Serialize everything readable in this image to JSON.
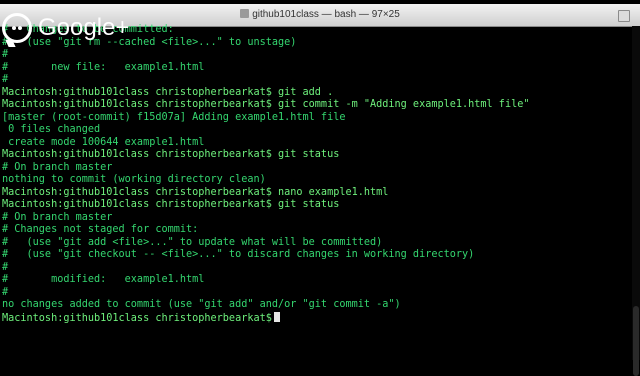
{
  "window": {
    "title": "github101class — bash — 97×25"
  },
  "overlay": {
    "label": "Google+"
  },
  "terminal": {
    "lines": [
      "#   Changes to be committed:",
      "#   (use \"git rm --cached <file>...\" to unstage)",
      "#",
      "#       new file:   example1.html",
      "#",
      "Macintosh:github101class christopherbearkat$ git add .",
      "Macintosh:github101class christopherbearkat$ git commit -m \"Adding example1.html file\"",
      "[master (root-commit) f15d07a] Adding example1.html file",
      " 0 files changed",
      " create mode 100644 example1.html",
      "Macintosh:github101class christopherbearkat$ git status",
      "# On branch master",
      "nothing to commit (working directory clean)",
      "Macintosh:github101class christopherbearkat$ nano example1.html",
      "Macintosh:github101class christopherbearkat$ git status",
      "# On branch master",
      "# Changes not staged for commit:",
      "#   (use \"git add <file>...\" to update what will be committed)",
      "#   (use \"git checkout -- <file>...\" to discard changes in working directory)",
      "#",
      "#       modified:   example1.html",
      "#",
      "no changes added to commit (use \"git add\" and/or \"git commit -a\")",
      "Macintosh:github101class christopherbearkat$"
    ]
  }
}
